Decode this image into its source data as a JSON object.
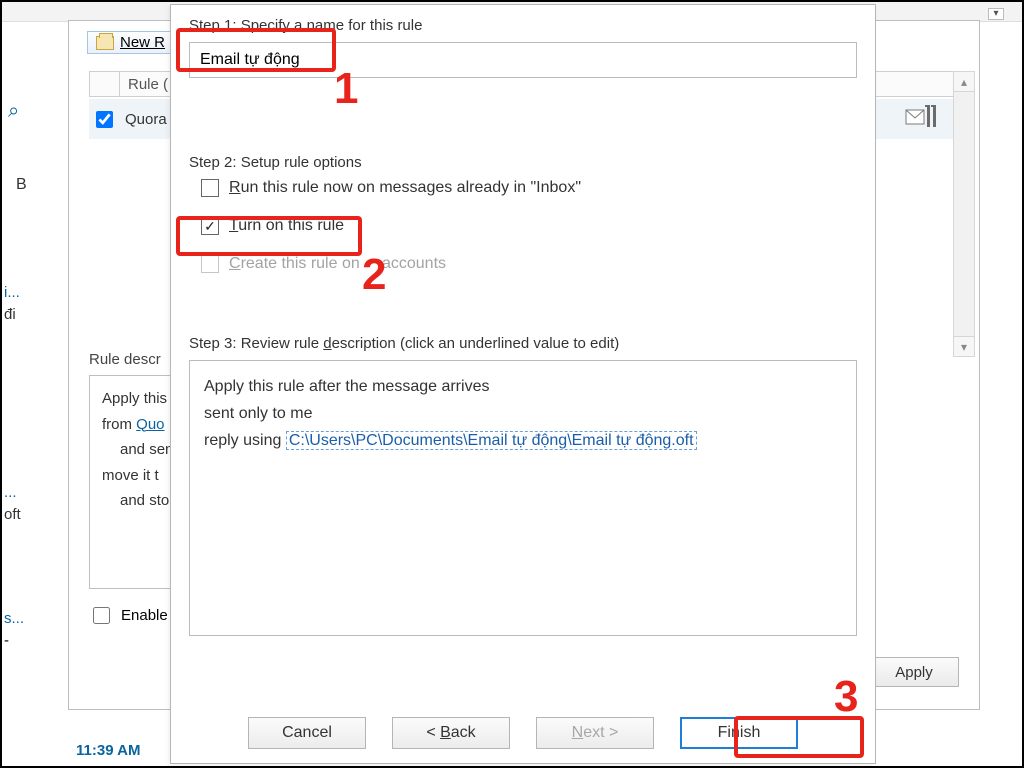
{
  "bg": {
    "newRule": "New R",
    "ruleHeader": "Rule (",
    "ruleRow": "Quora",
    "ruleDescLabel": "Rule descr",
    "rd_line1": "Apply this",
    "rd_line2a": "from ",
    "rd_line2b": "Quo",
    "rd_line3": "and sen",
    "rd_line4": "move it t",
    "rd_line5": "and sto",
    "enable": "Enable",
    "applyBtn": "Apply",
    "left_i": "i...",
    "left_di": "đi",
    "left_dots": "...",
    "left_oft": "oft",
    "left_s": "s...",
    "left_dash": "-",
    "searchChar": "⌕",
    "letterB": "B",
    "time": "11:39 AM",
    "dropdownGlyph": "▾"
  },
  "wizard": {
    "step1Label": "Step 1: Specify a name for this rule",
    "ruleName": "Email tự động",
    "step2Label": "Step 2: Setup rule options",
    "opt_run_pre": "R",
    "opt_run_post": "un this rule now on messages already in \"Inbox\"",
    "opt_turnon_pre": "T",
    "opt_turnon_post": "urn on this rule",
    "opt_allaccounts_pre": "C",
    "opt_allaccounts_mid": "reate this rule on",
    "opt_allaccounts_post": "accounts",
    "step3Label_pre": "Step 3: Review rule ",
    "step3Label_u": "d",
    "step3Label_post": "escription (click an underlined value to edit)",
    "desc_line1": "Apply this rule after the message arrives",
    "desc_line2": "sent only to me",
    "desc_line3a": "reply using ",
    "desc_template": "C:\\Users\\PC\\Documents\\Email tự động\\Email tự động.oft",
    "btn_cancel": "Cancel",
    "btn_back_pre": "< ",
    "btn_back_u": "B",
    "btn_back_post": "ack",
    "btn_next_u": "N",
    "btn_next_post": "ext >",
    "btn_finish": "Finish"
  },
  "annotations": {
    "n1": "1",
    "n2": "2",
    "n3": "3"
  }
}
